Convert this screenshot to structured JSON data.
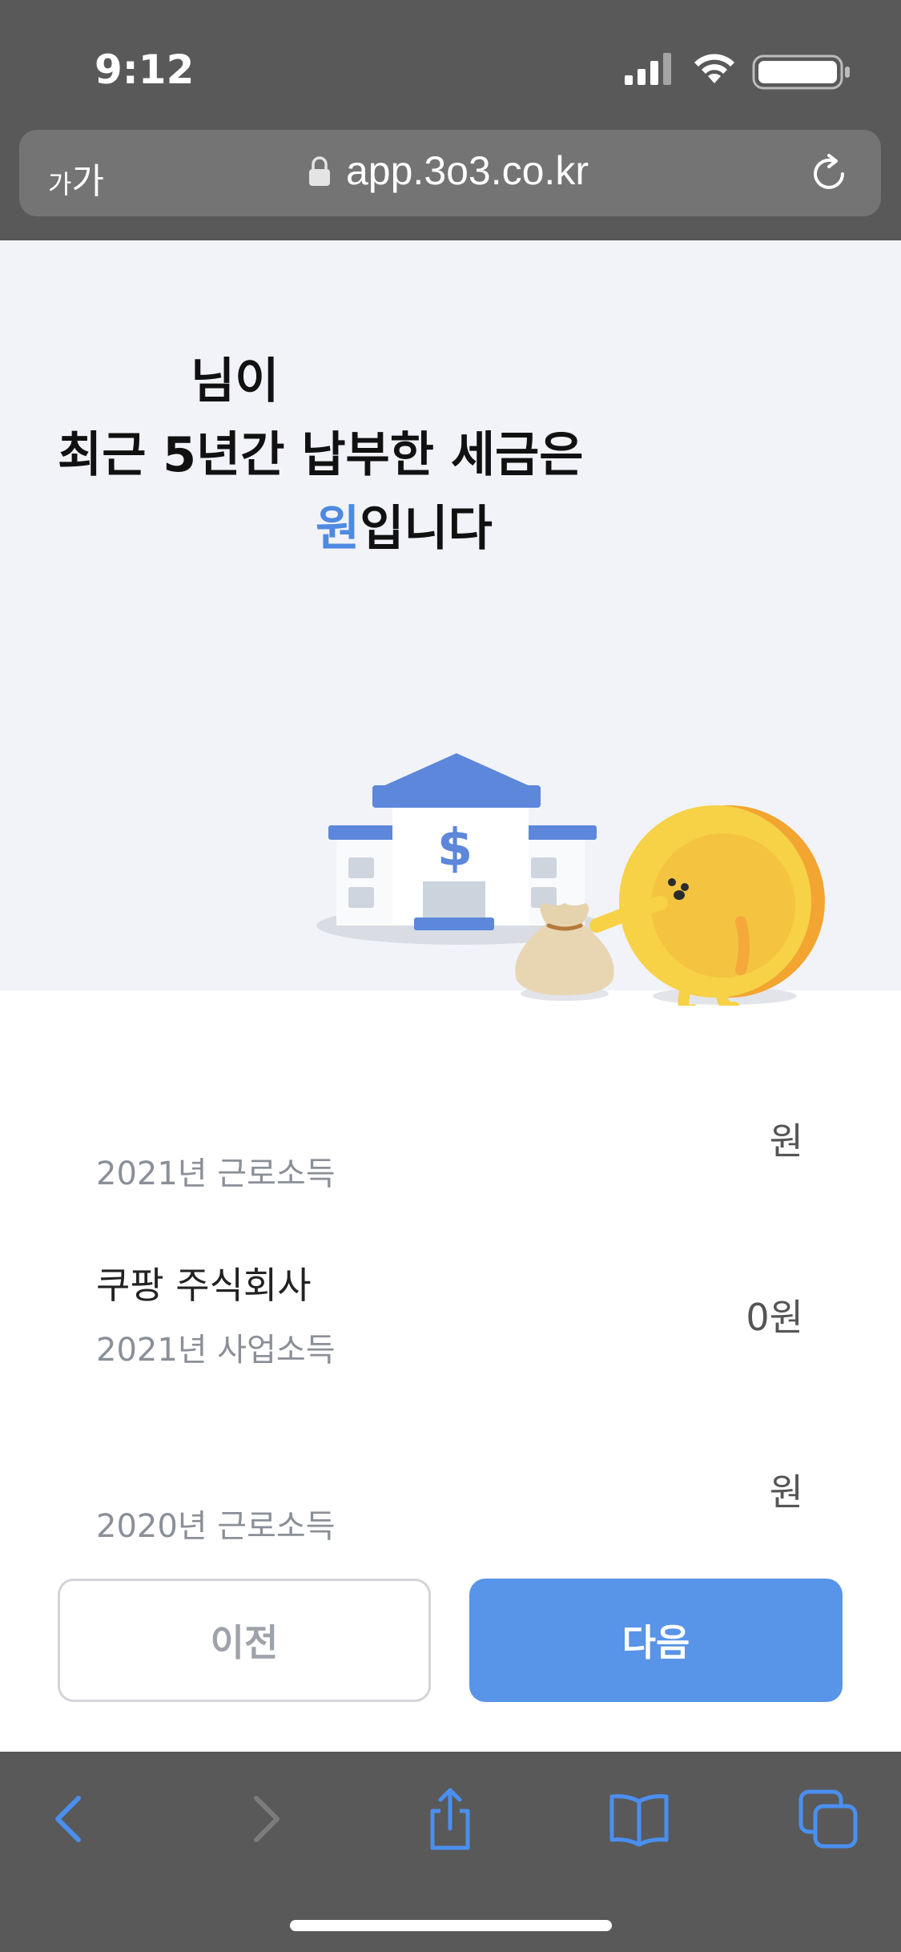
{
  "status_bar": {
    "time": "9:12"
  },
  "browser": {
    "text_size_label_small": "가",
    "text_size_label_large": "가",
    "url": "app.3o3.co.kr"
  },
  "hero": {
    "line1": "님이",
    "line2": "최근 5년간 납부한 세금은",
    "line3_accent": "원",
    "line3_rest": "입니다"
  },
  "income_list": [
    {
      "name": "",
      "subtitle": "2021년 근로소득",
      "amount": "원"
    },
    {
      "name": "쿠팡 주식회사",
      "subtitle": "2021년 사업소득",
      "amount": "0원"
    },
    {
      "name": "",
      "subtitle": "2020년 근로소득",
      "amount": "원"
    }
  ],
  "buttons": {
    "prev": "이전",
    "next": "다음"
  },
  "colors": {
    "accent": "#4e89e2",
    "primary_button": "#5894e8",
    "hero_bg": "#f1f3f8",
    "chrome": "#595959"
  },
  "icons": [
    "signal-icon",
    "wifi-icon",
    "battery-icon",
    "lock-icon",
    "reload-icon",
    "back-icon",
    "forward-icon",
    "share-icon",
    "bookmarks-icon",
    "tabs-icon"
  ]
}
